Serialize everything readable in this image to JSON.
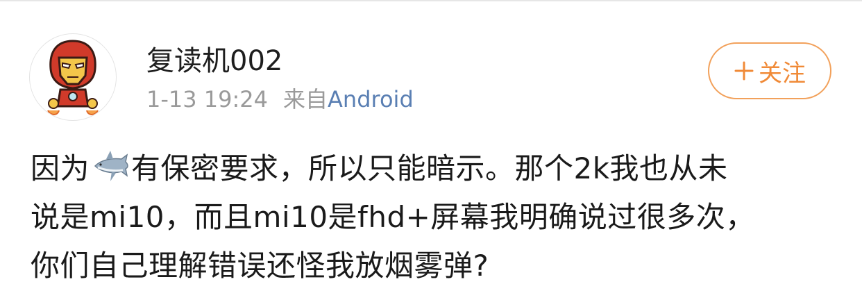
{
  "post": {
    "username": "复读机002",
    "timestamp": "1-13 19:24",
    "from_label": "来自",
    "source": "Android",
    "follow_label": "关注",
    "avatar_icon": "iron-man-avatar",
    "content": {
      "line1_before": "因为",
      "emoji_name": "shark-emoji",
      "line1_after": "有保密要求，所以只能暗示。那个2k我也从未",
      "line2": "说是mi10，而且mi10是fhd+屏幕我明确说过很多次，",
      "line3": "你们自己理解错误还怪我放烟雾弹?"
    }
  },
  "colors": {
    "accent": "#f08a37",
    "source_link": "#5a7fb3",
    "meta_text": "#9a9a9a"
  }
}
